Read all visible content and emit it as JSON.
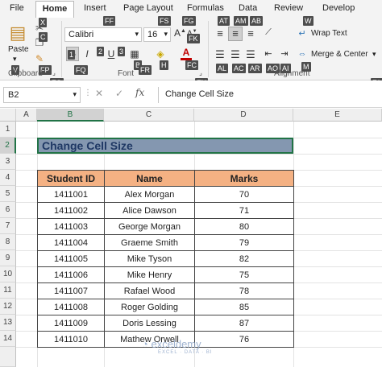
{
  "tabs": [
    "File",
    "Home",
    "Insert",
    "Page Layout",
    "Formulas",
    "Data",
    "Review",
    "Develop"
  ],
  "keytips": {
    "x": "X",
    "c": "C",
    "v": "V",
    "fp": "FP",
    "fo": "FO",
    "ff": "FF",
    "fs": "FS",
    "fg": "FG",
    "fk": "FK",
    "one": "1",
    "two": "2",
    "three": "3",
    "b": "B",
    "h": "H",
    "fc": "FC",
    "fn": "FN",
    "fq": "FQ",
    "fr": "FR",
    "fa": "FA",
    "at": "AT",
    "am": "AM",
    "ab": "AB",
    "w": "W",
    "al": "AL",
    "ac": "AC",
    "ar": "AR",
    "ai": "AI",
    "ao": "AO",
    "m": "M"
  },
  "clipboard": {
    "paste_label": "Paste",
    "group_label": "Clipboard"
  },
  "font": {
    "name": "Calibri",
    "size": "16",
    "group_label": "Font"
  },
  "alignment": {
    "wrap_text": "Wrap Text",
    "merge_center": "Merge & Center",
    "group_label": "Alignment"
  },
  "formula_bar": {
    "name_box": "B2",
    "fx": "fx",
    "content": "Change Cell Size"
  },
  "columns": [
    "A",
    "B",
    "C",
    "D",
    "E"
  ],
  "rows": [
    "1",
    "2",
    "3",
    "4",
    "5",
    "6",
    "7",
    "8",
    "9",
    "10",
    "11",
    "12",
    "13",
    "14"
  ],
  "sheet": {
    "title": "Change Cell Size",
    "headers": [
      "Student ID",
      "Name",
      "Marks"
    ],
    "records": [
      [
        "1411001",
        "Alex Morgan",
        "70"
      ],
      [
        "1411002",
        "Alice Dawson",
        "71"
      ],
      [
        "1411003",
        "George Morgan",
        "80"
      ],
      [
        "1411004",
        "Graeme Smith",
        "79"
      ],
      [
        "1411005",
        "Mike Tyson",
        "82"
      ],
      [
        "1411006",
        "Mike Henry",
        "75"
      ],
      [
        "1411007",
        "Rafael Wood",
        "78"
      ],
      [
        "1411008",
        "Roger Golding",
        "85"
      ],
      [
        "1411009",
        "Doris Lessing",
        "87"
      ],
      [
        "1411010",
        "Mathew Orwell",
        "76"
      ]
    ]
  },
  "watermark": {
    "brand": "exceldemy",
    "tagline": "EXCEL · DATA · BI"
  },
  "colors": {
    "header_fill": "#f4b183",
    "title_fill": "#8497b0",
    "selection": "#217346"
  }
}
